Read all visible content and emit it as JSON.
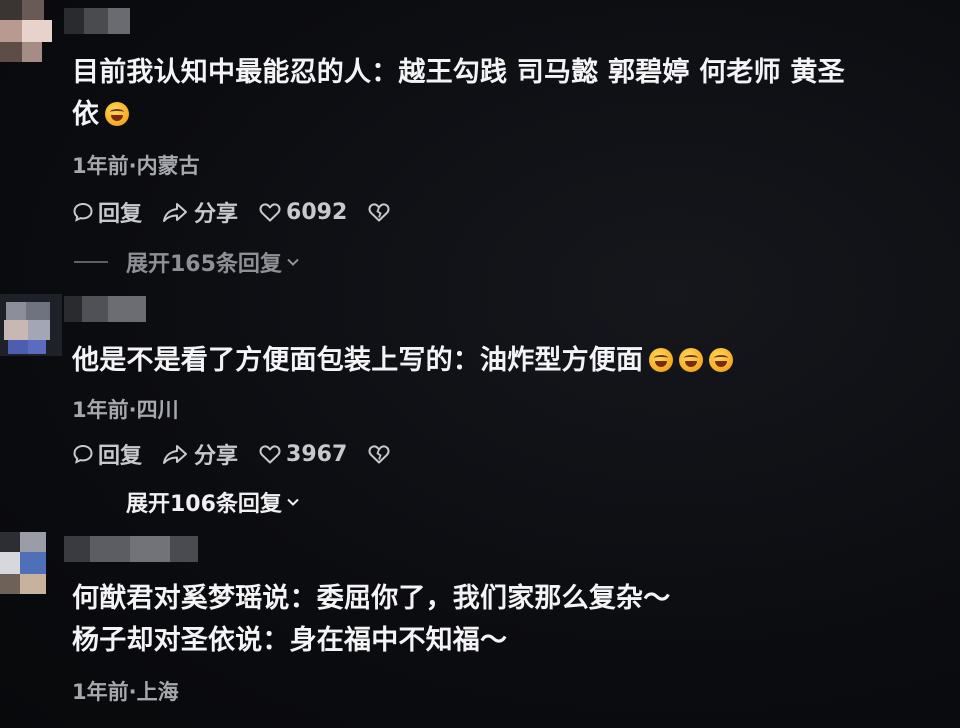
{
  "comments": [
    {
      "text_lines": [
        "目前我认知中最能忍的人：越王勾践 司马懿 郭碧婷 何老师 黄圣",
        "依"
      ],
      "meta": "1年前·内蒙古",
      "reply_label": "回复",
      "share_label": "分享",
      "like_count": "6092",
      "expand_label": "展开165条回复"
    },
    {
      "text_lines": [
        "他是不是看了方便面包装上写的：油炸型方便面"
      ],
      "meta": "1年前·四川",
      "reply_label": "回复",
      "share_label": "分享",
      "like_count": "3967",
      "expand_label": "展开106条回复"
    },
    {
      "text_lines": [
        "何猷君对奚梦瑶说：委屈你了，我们家那么复杂～",
        "杨子却对圣依说：身在福中不知福～"
      ],
      "meta": "1年前·上海"
    }
  ],
  "icons": {
    "reply": "speech-bubble-icon",
    "share": "share-arrow-icon",
    "like": "heart-icon",
    "dislike": "broken-heart-icon",
    "expand": "chevron-down-icon",
    "emoji": "laughing-face-emoji"
  }
}
